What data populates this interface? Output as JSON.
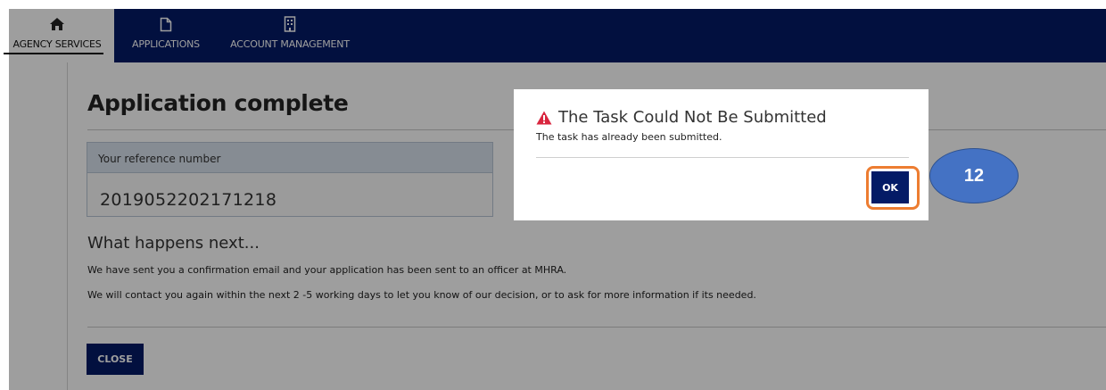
{
  "nav": {
    "items": [
      {
        "label": "AGENCY SERVICES",
        "icon": "home-icon",
        "active": true
      },
      {
        "label": "APPLICATIONS",
        "icon": "document-icon",
        "active": false
      },
      {
        "label": "ACCOUNT MANAGEMENT",
        "icon": "building-icon",
        "active": false
      }
    ]
  },
  "page": {
    "title": "Application complete",
    "reference": {
      "label": "Your reference number",
      "value": "2019052202171218"
    },
    "next_heading": "What happens next...",
    "paragraphs": [
      "We have sent you a confirmation email and your application has been sent to an officer at MHRA.",
      "We will contact you again within the next 2 -5 working days to let you know of our decision, or to ask for more information if its needed."
    ],
    "close_label": "CLOSE"
  },
  "modal": {
    "title": "The Task Could Not Be Submitted",
    "icon": "warning-icon",
    "message": "The task has already been submitted.",
    "ok_label": "OK"
  },
  "annotation": {
    "step": "12"
  },
  "colors": {
    "navy": "#041b66",
    "warning": "#d9263f",
    "highlight": "#ed7d31",
    "badge": "#4472c4"
  }
}
